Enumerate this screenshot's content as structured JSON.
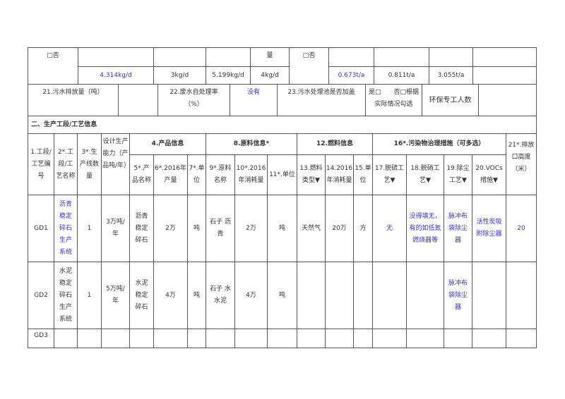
{
  "top_table": {
    "r1": {
      "c1": "□否",
      "c5": "量",
      "c6": "□否"
    },
    "r2": {
      "v1": "4.314kg/d",
      "v2": "3kg/d",
      "v3": "5.199kg/d",
      "v4": "4kg/d",
      "v5": "0.673t/a",
      "v6": "0.811t/a",
      "v7": "3.055t/a"
    }
  },
  "water_row": {
    "l1": "21.污水排放量（吨）",
    "l2": "22.废水自处理率（%）",
    "v2": "没有",
    "l3": "23.污水处理池是否加盖",
    "opt": "是□　　否□根据实际情况勾选",
    "l4": "环保专工人数"
  },
  "section_title": "二、生产工段/工艺信息",
  "headers": {
    "h1": "1.工段/工艺编号",
    "h2": "2*.工段/工艺名称",
    "h3": "3*.生产线数量",
    "h4": "设计生产能力（产品吨/年）",
    "g_product": "4.产品信息",
    "h5": "5*.产品名称",
    "h6": "6*.2016年产量",
    "h7": "7*.单位",
    "g_raw": "8.原料信息*",
    "h9": "9*.原料名称",
    "h10": "10*.2016年消耗量",
    "h11": "11*.单位",
    "g_fuel": "12.燃料信息",
    "h13": "13.燃料类型▼",
    "h14": "14.2016年消耗量",
    "h15": "15.单位",
    "g_pollution": "16*.污染物治理措施（可多选）",
    "h17": "17.脱硫工艺▼",
    "h18": "18.脱硝工艺▼",
    "h19": "19.除尘工艺▼",
    "h20": "20.VOCs措施▼",
    "h21": "21*.排放口高度（米）"
  },
  "rows": [
    {
      "id": "GD1",
      "name": "沥青稳定碎石生产系统",
      "lines": "1",
      "capacity": "3万吨/年",
      "product": "沥青稳定碎石",
      "output": "2万",
      "unit": "吨",
      "raw": "石子 沥青",
      "raw_qty": "2万",
      "raw_unit": "吨",
      "fuel": "天然气",
      "fuel_qty": "20万",
      "fuel_unit": "方",
      "desulf": "无",
      "denitr": "没得填无，有的如低氮燃烧器等",
      "dust": "脉冲布袋除尘器",
      "vocs": "活性炭吸附除尘器",
      "height": "20"
    },
    {
      "id": "GD2",
      "name": "水泥稳定碎石生产系统",
      "lines": "1",
      "capacity": "5万吨/年",
      "product": "水泥稳定碎石",
      "output": "4万",
      "unit": "吨",
      "raw": "石子 水 水泥",
      "raw_qty": "4万",
      "raw_unit": "吨",
      "fuel": "",
      "fuel_qty": "",
      "fuel_unit": "",
      "desulf": "",
      "denitr": "",
      "dust": "脉冲布袋除尘器",
      "vocs": "",
      "height": ""
    },
    {
      "id": "GD3"
    }
  ]
}
